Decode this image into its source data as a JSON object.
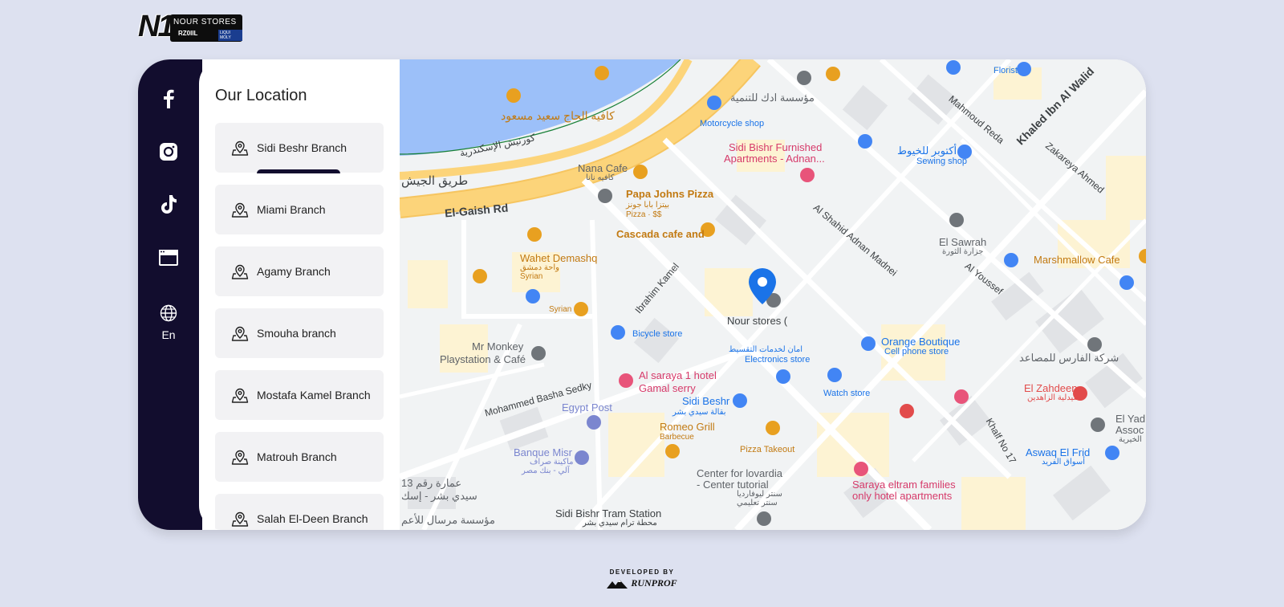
{
  "logo": {
    "brand_text": "NOUR STORES",
    "mark": "N1",
    "sub_text": "RZ0IIL",
    "badge_text": "LIQUI MOLY"
  },
  "social": {
    "items": [
      {
        "icon": "facebook-icon"
      },
      {
        "icon": "instagram-icon"
      },
      {
        "icon": "tiktok-icon"
      },
      {
        "icon": "website-icon"
      }
    ],
    "language_label": "En"
  },
  "panel": {
    "title": "Our Location",
    "branches": [
      {
        "label": "Sidi Beshr Branch",
        "active": true
      },
      {
        "label": "Miami Branch",
        "active": false
      },
      {
        "label": "Agamy Branch",
        "active": false
      },
      {
        "label": "Smouha branch",
        "active": false
      },
      {
        "label": "Mostafa Kamel Branch",
        "active": false
      },
      {
        "label": "Matrouh Branch",
        "active": false
      },
      {
        "label": "Salah El-Deen Branch",
        "active": false
      }
    ]
  },
  "map": {
    "labels": {
      "cafe_said": "كافيه الحاج سعيد مسعود",
      "corniche": "كورنيش الإسكندرية",
      "army_road_ar": "طريق الجيش",
      "el_gaish": "El-Gaish Rd",
      "nana_cafe": "Nana Cafe",
      "nana_cafe_ar": "كافيه نانا",
      "papa_johns": "Papa Johns Pizza",
      "papa_johns_ar": "بيتزا بابا جونز",
      "papa_johns_sub": "Pizza · $$",
      "cascada": "Cascada cafe and",
      "wahet": "Wahet Demashq",
      "wahet_ar": "واحة دمشق",
      "wahet_sub": "Syrian",
      "syrian": "Syrian",
      "mr_monkey": "Mr Monkey",
      "mr_monkey_2": "Playstation & Café",
      "mohammed_basha": "Mohammed Basha Sedky",
      "egypt_post": "Egypt Post",
      "banque_misr": "Banque Misr",
      "banque_misr_ar": "ماكينة صراف",
      "banque_misr_ar2": "آلي - بنك مصر",
      "building_13": "عمارة رقم 13",
      "sidi_beshr_ar": "سيدي بشر - إسك",
      "mersal": "مؤسسة مرسال للأعم",
      "sidi_beshr_tram": "Sidi Bishr Tram Station",
      "sidi_beshr_tram_ar": "محطة ترام سيدي بشر",
      "moto_shop_ar": "مؤسسة ادك للتنمية",
      "moto_shop": "Motorcycle shop",
      "sidi_bishr_furnished": "Sidi Bishr Furnished",
      "sidi_bishr_furnished_2": "Apartments - Adnan...",
      "ibrahim_kamel": "Ibrahim Kamel",
      "bicycle_store": "Bicycle store",
      "nour_stores": "Nour stores (",
      "al_saraya": "Al saraya 1 hotel",
      "gamal_serry": "Gamal serry",
      "sidi_beshr": "Sidi Beshr",
      "sidi_beshr_ar2": "بقالة سيدي بشر",
      "romeo": "Romeo Grill",
      "romeo_sub": "Barbecue",
      "pizza_takeout": "Pizza Takeout",
      "lovardia": "Center for lovardia",
      "lovardia_2": "- Center tutorial",
      "lovardia_ar": "سنتر ليوفارديا",
      "lovardia_ar2": "سنتر تعليمي",
      "aman_ar": "امان لخدمات التقسيط",
      "electronics": "Electronics store",
      "watch_store": "Watch store",
      "orange": "Orange Boutique",
      "orange_sub": "Cell phone store",
      "al_shahid": "Al Shahid Adnan Madnei",
      "el_sawrah": "El Sawrah",
      "el_sawrah_ar": "جزارة الثورة",
      "al_youssef": "Al Youssef",
      "marshmallow": "Marshmallow Cafe",
      "mahmoud_reda": "Mahmoud Reda",
      "khaled": "Khaled Ibn Al Walid",
      "zakareya": "Zakareya Ahmed",
      "florist": "Florist",
      "sewing_ar": "أكتوبر للخيوط",
      "sewing": "Sewing shop",
      "faris_ar": "شركة الفارس للمصاعد",
      "el_zahdeen": "El Zahdeen",
      "el_zahdeen_ar": "صيدلية الزاهدين",
      "el_yad": "El Yad",
      "el_yad_2": "Assoc",
      "el_yad_ar": "الخيرية",
      "aswaq": "Aswaq El Frid",
      "aswaq_ar": "أسواق الفريد",
      "khalf": "Khalf No 17",
      "saraya_eltram": "Saraya eltram families",
      "saraya_eltram_2": "only hotel apartments"
    }
  },
  "footer": {
    "developed_by": "DEVELOPED BY",
    "company": "RUNPROF"
  },
  "colors": {
    "sidebar": "#120d2e",
    "background": "#dde1f0",
    "water": "#9cc0f9",
    "road_major": "#fcd47a",
    "marker": "#1a73e8"
  }
}
